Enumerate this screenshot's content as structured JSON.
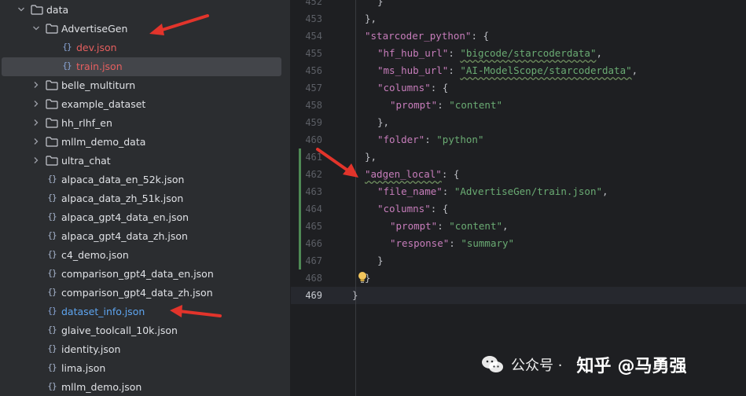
{
  "tree": {
    "items": [
      {
        "label": "data",
        "type": "folder",
        "depth": 0,
        "expanded": true
      },
      {
        "label": "AdvertiseGen",
        "type": "folder",
        "depth": 1,
        "expanded": true
      },
      {
        "label": "dev.json",
        "type": "file",
        "depth": 2,
        "color": "red"
      },
      {
        "label": "train.json",
        "type": "file",
        "depth": 2,
        "color": "red",
        "selected": true
      },
      {
        "label": "belle_multiturn",
        "type": "folder",
        "depth": 1,
        "expanded": false
      },
      {
        "label": "example_dataset",
        "type": "folder",
        "depth": 1,
        "expanded": false
      },
      {
        "label": "hh_rlhf_en",
        "type": "folder",
        "depth": 1,
        "expanded": false
      },
      {
        "label": "mllm_demo_data",
        "type": "folder",
        "depth": 1,
        "expanded": false
      },
      {
        "label": "ultra_chat",
        "type": "folder",
        "depth": 1,
        "expanded": false
      },
      {
        "label": "alpaca_data_en_52k.json",
        "type": "file",
        "depth": 1
      },
      {
        "label": "alpaca_data_zh_51k.json",
        "type": "file",
        "depth": 1
      },
      {
        "label": "alpaca_gpt4_data_en.json",
        "type": "file",
        "depth": 1
      },
      {
        "label": "alpaca_gpt4_data_zh.json",
        "type": "file",
        "depth": 1
      },
      {
        "label": "c4_demo.json",
        "type": "file",
        "depth": 1
      },
      {
        "label": "comparison_gpt4_data_en.json",
        "type": "file",
        "depth": 1
      },
      {
        "label": "comparison_gpt4_data_zh.json",
        "type": "file",
        "depth": 1
      },
      {
        "label": "dataset_info.json",
        "type": "file",
        "depth": 1,
        "color": "blue"
      },
      {
        "label": "glaive_toolcall_10k.json",
        "type": "file",
        "depth": 1
      },
      {
        "label": "identity.json",
        "type": "file",
        "depth": 1
      },
      {
        "label": "lima.json",
        "type": "file",
        "depth": 1
      },
      {
        "label": "mllm_demo.json",
        "type": "file",
        "depth": 1
      }
    ],
    "file_icon_glyph": "{}"
  },
  "editor": {
    "current_line": "469",
    "lines": [
      {
        "num": "452",
        "indent": 3,
        "tokens": [
          {
            "t": "}",
            "c": "punc"
          }
        ]
      },
      {
        "num": "453",
        "indent": 2,
        "tokens": [
          {
            "t": "},",
            "c": "punc"
          }
        ]
      },
      {
        "num": "454",
        "indent": 2,
        "tokens": [
          {
            "t": "\"starcoder_python\"",
            "c": "key"
          },
          {
            "t": ": {",
            "c": "punc"
          }
        ]
      },
      {
        "num": "455",
        "indent": 3,
        "tokens": [
          {
            "t": "\"hf_hub_url\"",
            "c": "key"
          },
          {
            "t": ": ",
            "c": "punc"
          },
          {
            "t": "\"bigcode/starcoderdata\"",
            "c": "str",
            "squiggle": true
          },
          {
            "t": ",",
            "c": "punc"
          }
        ]
      },
      {
        "num": "456",
        "indent": 3,
        "tokens": [
          {
            "t": "\"ms_hub_url\"",
            "c": "key"
          },
          {
            "t": ": ",
            "c": "punc"
          },
          {
            "t": "\"AI-ModelScope/starcoderdata\"",
            "c": "str",
            "squiggle": true
          },
          {
            "t": ",",
            "c": "punc"
          }
        ]
      },
      {
        "num": "457",
        "indent": 3,
        "tokens": [
          {
            "t": "\"columns\"",
            "c": "key"
          },
          {
            "t": ": {",
            "c": "punc"
          }
        ]
      },
      {
        "num": "458",
        "indent": 4,
        "tokens": [
          {
            "t": "\"prompt\"",
            "c": "key"
          },
          {
            "t": ": ",
            "c": "punc"
          },
          {
            "t": "\"content\"",
            "c": "str"
          }
        ]
      },
      {
        "num": "459",
        "indent": 3,
        "tokens": [
          {
            "t": "},",
            "c": "punc"
          }
        ]
      },
      {
        "num": "460",
        "indent": 3,
        "tokens": [
          {
            "t": "\"folder\"",
            "c": "key"
          },
          {
            "t": ": ",
            "c": "punc"
          },
          {
            "t": "\"python\"",
            "c": "str"
          }
        ]
      },
      {
        "num": "461",
        "indent": 2,
        "tokens": [
          {
            "t": "},",
            "c": "punc"
          }
        ]
      },
      {
        "num": "462",
        "indent": 2,
        "tokens": [
          {
            "t": "\"adgen_local\"",
            "c": "key",
            "squiggle": true
          },
          {
            "t": ": {",
            "c": "punc"
          }
        ]
      },
      {
        "num": "463",
        "indent": 3,
        "tokens": [
          {
            "t": "\"file_name\"",
            "c": "key"
          },
          {
            "t": ": ",
            "c": "punc"
          },
          {
            "t": "\"AdvertiseGen/train.json\"",
            "c": "str"
          },
          {
            "t": ",",
            "c": "punc"
          }
        ]
      },
      {
        "num": "464",
        "indent": 3,
        "tokens": [
          {
            "t": "\"columns\"",
            "c": "key"
          },
          {
            "t": ": {",
            "c": "punc"
          }
        ]
      },
      {
        "num": "465",
        "indent": 4,
        "tokens": [
          {
            "t": "\"prompt\"",
            "c": "key"
          },
          {
            "t": ": ",
            "c": "punc"
          },
          {
            "t": "\"content\"",
            "c": "str"
          },
          {
            "t": ",",
            "c": "punc"
          }
        ]
      },
      {
        "num": "466",
        "indent": 4,
        "tokens": [
          {
            "t": "\"response\"",
            "c": "key"
          },
          {
            "t": ": ",
            "c": "punc"
          },
          {
            "t": "\"summary\"",
            "c": "str"
          }
        ]
      },
      {
        "num": "467",
        "indent": 3,
        "tokens": [
          {
            "t": "}",
            "c": "punc"
          }
        ]
      },
      {
        "num": "468",
        "indent": 2,
        "tokens": [
          {
            "t": "}",
            "c": "punc"
          }
        ],
        "bulb": true
      },
      {
        "num": "469",
        "indent": 1,
        "tokens": [
          {
            "t": "}",
            "c": "punc"
          }
        ]
      }
    ]
  },
  "watermark": {
    "channel": "公众号 · ",
    "site": "知乎",
    "author": "@马勇强"
  },
  "colors": {
    "annotation_arrow": "#e2342b",
    "modified_gutter": "#4f8a55"
  }
}
